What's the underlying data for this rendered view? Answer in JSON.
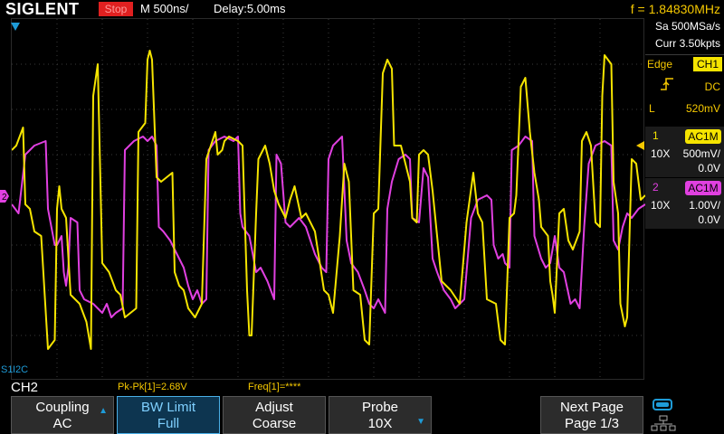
{
  "header": {
    "brand": "SIGLENT",
    "run_state": "Stop",
    "timebase": "M 500ns/",
    "delay": "Delay:5.00ms",
    "frequency": "f = 1.84830MHz"
  },
  "acquisition": {
    "sample_rate": "Sa 500MSa/s",
    "memory": "Curr 3.50kpts"
  },
  "trigger": {
    "type": "Edge",
    "source": "CH1",
    "coupling": "DC",
    "level_label": "L",
    "level": "520mV"
  },
  "channels": [
    {
      "number": "1",
      "coupling": "AC1M",
      "probe": "10X",
      "scale": "500mV/",
      "offset": "0.0V",
      "color": "#f5e400"
    },
    {
      "number": "2",
      "coupling": "AC1M",
      "probe": "10X",
      "scale": "1.00V/",
      "offset": "0.0V",
      "color": "#e040e0"
    }
  ],
  "decode": {
    "bus_label": "S1",
    "protocol": "I2C"
  },
  "measurement": {
    "active_channel": "CH2",
    "pkpk": "Pk-Pk[1]=2.68V",
    "freq": "Freq[1]=****"
  },
  "menu": {
    "coupling": {
      "title": "Coupling",
      "value": "AC"
    },
    "bw_limit": {
      "title": "BW Limit",
      "value": "Full"
    },
    "adjust": {
      "title": "Adjust",
      "value": "Coarse"
    },
    "probe": {
      "title": "Probe",
      "value": "10X"
    },
    "next_page": {
      "title": "Next Page",
      "value": "Page 1/3"
    }
  },
  "colors": {
    "ch1": "#f5e400",
    "ch2": "#e040e0",
    "accent": "#1e9bd7",
    "stop": "#e02020"
  },
  "waveforms": {
    "units": "divisions (x: 0-14 div, y: +4 to -4 div from center)",
    "ch1": [
      [
        0,
        1.1
      ],
      [
        0.1,
        1.2
      ],
      [
        0.25,
        1.6
      ],
      [
        0.3,
        -0.1
      ],
      [
        0.4,
        -0.2
      ],
      [
        0.5,
        -0.7
      ],
      [
        0.65,
        -0.8
      ],
      [
        0.8,
        -3.3
      ],
      [
        0.95,
        -3.1
      ],
      [
        1.0,
        -0.2
      ],
      [
        1.05,
        0.3
      ],
      [
        1.1,
        -0.2
      ],
      [
        1.2,
        -0.4
      ],
      [
        1.3,
        -2.1
      ],
      [
        1.5,
        -2.3
      ],
      [
        1.65,
        -2.7
      ],
      [
        1.75,
        -3.3
      ],
      [
        1.8,
        2.3
      ],
      [
        1.9,
        3.0
      ],
      [
        2.0,
        -1.4
      ],
      [
        2.15,
        -1.6
      ],
      [
        2.3,
        -2.0
      ],
      [
        2.4,
        -2.1
      ],
      [
        2.5,
        -2.6
      ],
      [
        2.75,
        -2.4
      ],
      [
        2.8,
        1.5
      ],
      [
        2.95,
        1.7
      ],
      [
        3.0,
        3.1
      ],
      [
        3.05,
        3.3
      ],
      [
        3.1,
        3.1
      ],
      [
        3.2,
        0.5
      ],
      [
        3.3,
        0.4
      ],
      [
        3.55,
        0.6
      ],
      [
        3.6,
        -1.6
      ],
      [
        3.7,
        -1.9
      ],
      [
        3.8,
        -2.0
      ],
      [
        3.9,
        -2.4
      ],
      [
        4.05,
        -2.6
      ],
      [
        4.2,
        -2.3
      ],
      [
        4.3,
        0.9
      ],
      [
        4.4,
        1.2
      ],
      [
        4.5,
        1.5
      ],
      [
        4.55,
        1.0
      ],
      [
        4.65,
        1.1
      ],
      [
        4.7,
        1.3
      ],
      [
        4.8,
        1.4
      ],
      [
        5.0,
        1.3
      ],
      [
        5.1,
        1.2
      ],
      [
        5.2,
        -2.0
      ],
      [
        5.25,
        -3.0
      ],
      [
        5.3,
        -3.0
      ],
      [
        5.4,
        -0.3
      ],
      [
        5.45,
        0.9
      ],
      [
        5.6,
        1.2
      ],
      [
        5.7,
        0.8
      ],
      [
        5.8,
        0.2
      ],
      [
        5.9,
        -0.1
      ],
      [
        6.05,
        -0.4
      ],
      [
        6.15,
        0.0
      ],
      [
        6.25,
        0.3
      ],
      [
        6.4,
        -0.4
      ],
      [
        6.5,
        -0.3
      ],
      [
        6.7,
        -0.7
      ],
      [
        6.9,
        -2.0
      ],
      [
        7.0,
        -2.1
      ],
      [
        7.1,
        -2.5
      ],
      [
        7.25,
        -0.8
      ],
      [
        7.35,
        0.8
      ],
      [
        7.45,
        0.4
      ],
      [
        7.55,
        -2.0
      ],
      [
        7.7,
        -2.1
      ],
      [
        7.8,
        -3.1
      ],
      [
        7.9,
        -3.2
      ],
      [
        8.0,
        -0.3
      ],
      [
        8.1,
        -0.2
      ],
      [
        8.2,
        2.8
      ],
      [
        8.3,
        3.1
      ],
      [
        8.4,
        2.9
      ],
      [
        8.45,
        1.2
      ],
      [
        8.6,
        1.2
      ],
      [
        8.8,
        0.4
      ],
      [
        8.85,
        -0.4
      ],
      [
        8.95,
        -0.5
      ],
      [
        9.0,
        1.0
      ],
      [
        9.1,
        1.1
      ],
      [
        9.2,
        1.0
      ],
      [
        9.3,
        0.2
      ],
      [
        9.5,
        -1.8
      ],
      [
        9.7,
        -2.0
      ],
      [
        9.9,
        -2.3
      ],
      [
        10.05,
        -0.5
      ],
      [
        10.2,
        0.6
      ],
      [
        10.3,
        -0.3
      ],
      [
        10.4,
        -0.5
      ],
      [
        10.5,
        -2.2
      ],
      [
        10.7,
        -2.3
      ],
      [
        10.8,
        -3.1
      ],
      [
        10.9,
        -3.2
      ],
      [
        11.0,
        -0.4
      ],
      [
        11.1,
        -0.3
      ],
      [
        11.15,
        0.1
      ],
      [
        11.25,
        2.5
      ],
      [
        11.35,
        2.7
      ],
      [
        11.45,
        1.5
      ],
      [
        11.55,
        0.6
      ],
      [
        11.65,
        0.0
      ],
      [
        11.7,
        -0.6
      ],
      [
        11.85,
        -0.8
      ],
      [
        11.9,
        -1.8
      ],
      [
        11.95,
        -2.1
      ],
      [
        12.0,
        -2.5
      ],
      [
        12.1,
        -0.3
      ],
      [
        12.2,
        -0.2
      ],
      [
        12.3,
        -0.9
      ],
      [
        12.4,
        -1.1
      ],
      [
        12.55,
        -0.7
      ],
      [
        12.6,
        1.3
      ],
      [
        12.7,
        1.5
      ],
      [
        12.8,
        1.2
      ],
      [
        12.9,
        -0.5
      ],
      [
        13.0,
        -0.6
      ],
      [
        13.05,
        2.3
      ],
      [
        13.1,
        3.2
      ],
      [
        13.25,
        3.0
      ],
      [
        13.3,
        0.4
      ],
      [
        13.4,
        -0.3
      ],
      [
        13.45,
        -2.3
      ],
      [
        13.55,
        -2.8
      ],
      [
        13.6,
        -2.6
      ],
      [
        13.7,
        0.9
      ],
      [
        13.8,
        0.8
      ],
      [
        13.9,
        0.0
      ],
      [
        14.0,
        0.1
      ]
    ],
    "ch2": [
      [
        0,
        -0.1
      ],
      [
        0.15,
        -0.3
      ],
      [
        0.3,
        1.0
      ],
      [
        0.5,
        1.2
      ],
      [
        0.75,
        1.3
      ],
      [
        0.8,
        -0.2
      ],
      [
        0.95,
        -1.0
      ],
      [
        1.0,
        -1.0
      ],
      [
        1.1,
        -0.8
      ],
      [
        1.15,
        -1.6
      ],
      [
        1.2,
        -1.9
      ],
      [
        1.25,
        -1.5
      ],
      [
        1.3,
        -0.4
      ],
      [
        1.45,
        -0.5
      ],
      [
        1.5,
        -2.0
      ],
      [
        1.6,
        -2.2
      ],
      [
        1.8,
        -2.3
      ],
      [
        1.9,
        -2.4
      ],
      [
        2.0,
        -2.5
      ],
      [
        2.1,
        -2.3
      ],
      [
        2.2,
        -2.6
      ],
      [
        2.3,
        -2.5
      ],
      [
        2.45,
        -2.4
      ],
      [
        2.5,
        1.1
      ],
      [
        2.7,
        1.3
      ],
      [
        2.9,
        1.4
      ],
      [
        3.0,
        1.3
      ],
      [
        3.1,
        1.4
      ],
      [
        3.2,
        1.2
      ],
      [
        3.25,
        -0.6
      ],
      [
        3.35,
        -0.7
      ],
      [
        3.5,
        -0.9
      ],
      [
        3.65,
        -1.2
      ],
      [
        3.8,
        -1.5
      ],
      [
        3.9,
        -1.9
      ],
      [
        4.0,
        -2.2
      ],
      [
        4.1,
        -2.0
      ],
      [
        4.2,
        -2.3
      ],
      [
        4.3,
        -2.2
      ],
      [
        4.35,
        1.1
      ],
      [
        4.5,
        1.3
      ],
      [
        4.7,
        1.4
      ],
      [
        4.9,
        1.3
      ],
      [
        5.0,
        1.4
      ],
      [
        5.05,
        -0.3
      ],
      [
        5.1,
        -0.6
      ],
      [
        5.25,
        -0.8
      ],
      [
        5.4,
        -1.6
      ],
      [
        5.5,
        -1.5
      ],
      [
        5.65,
        -1.8
      ],
      [
        5.8,
        -2.2
      ],
      [
        5.85,
        1.0
      ],
      [
        5.95,
        0.8
      ],
      [
        6.05,
        -0.5
      ],
      [
        6.15,
        -0.6
      ],
      [
        6.35,
        -0.4
      ],
      [
        6.5,
        -0.6
      ],
      [
        6.7,
        -1.2
      ],
      [
        6.85,
        -1.5
      ],
      [
        6.95,
        -1.6
      ],
      [
        7.0,
        0.9
      ],
      [
        7.1,
        1.2
      ],
      [
        7.3,
        1.4
      ],
      [
        7.4,
        -0.9
      ],
      [
        7.5,
        -1.4
      ],
      [
        7.65,
        -1.6
      ],
      [
        7.8,
        -2.0
      ],
      [
        7.9,
        -2.3
      ],
      [
        8.0,
        -2.4
      ],
      [
        8.1,
        -2.2
      ],
      [
        8.25,
        -2.5
      ],
      [
        8.3,
        -0.2
      ],
      [
        8.4,
        0.4
      ],
      [
        8.55,
        0.9
      ],
      [
        8.7,
        1.0
      ],
      [
        8.8,
        0.9
      ],
      [
        8.85,
        -0.4
      ],
      [
        9.0,
        -0.5
      ],
      [
        9.1,
        0.7
      ],
      [
        9.2,
        0.5
      ],
      [
        9.3,
        -1.3
      ],
      [
        9.4,
        -1.6
      ],
      [
        9.55,
        -2.0
      ],
      [
        9.7,
        -2.2
      ],
      [
        9.8,
        -2.4
      ],
      [
        9.9,
        -2.3
      ],
      [
        10.0,
        -2.2
      ],
      [
        10.15,
        -0.4
      ],
      [
        10.3,
        0.0
      ],
      [
        10.5,
        0.1
      ],
      [
        10.6,
        0.0
      ],
      [
        10.65,
        -1.0
      ],
      [
        10.75,
        -1.3
      ],
      [
        10.85,
        -1.2
      ],
      [
        10.9,
        -1.4
      ],
      [
        11.0,
        -1.5
      ],
      [
        11.05,
        1.1
      ],
      [
        11.2,
        1.2
      ],
      [
        11.35,
        1.4
      ],
      [
        11.5,
        1.3
      ],
      [
        11.55,
        -0.8
      ],
      [
        11.7,
        -1.3
      ],
      [
        11.8,
        -1.5
      ],
      [
        11.9,
        -1.4
      ],
      [
        12.0,
        -0.8
      ],
      [
        12.1,
        -1.5
      ],
      [
        12.2,
        -1.6
      ],
      [
        12.35,
        -2.3
      ],
      [
        12.45,
        -2.2
      ],
      [
        12.55,
        -2.4
      ],
      [
        12.65,
        -0.6
      ],
      [
        12.75,
        0.8
      ],
      [
        12.9,
        1.2
      ],
      [
        13.1,
        1.3
      ],
      [
        13.25,
        1.2
      ],
      [
        13.3,
        -0.9
      ],
      [
        13.4,
        -1.1
      ],
      [
        13.5,
        -0.6
      ],
      [
        13.6,
        -0.3
      ],
      [
        13.7,
        -0.4
      ],
      [
        13.85,
        -0.2
      ],
      [
        14.0,
        -0.1
      ]
    ]
  }
}
